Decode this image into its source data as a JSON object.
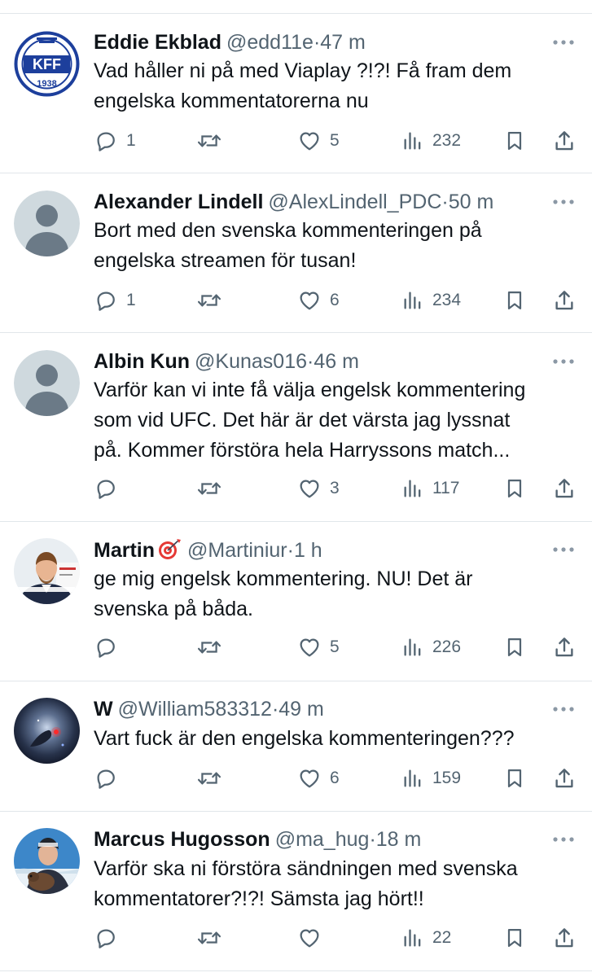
{
  "tweets": [
    {
      "name": "Eddie Ekblad",
      "handle": "@edd11e",
      "dot": "·",
      "time": "47 m",
      "text_lines": [
        "Vad håller ni på med Viaplay ?!?!  Få fram dem",
        "engelska kommentatorerna nu"
      ],
      "replies": "1",
      "retweets": "",
      "likes": "5",
      "views": "232",
      "avatar": "kff-logo",
      "avatar_text": "KFF",
      "avatar_year": "1938"
    },
    {
      "name": "Alexander Lindell",
      "handle": "@AlexLindell_PDC",
      "dot": "·",
      "time": "50 m",
      "text_lines": [
        "Bort med den svenska kommenteringen på",
        "engelska streamen för tusan!"
      ],
      "replies": "1",
      "retweets": "",
      "likes": "6",
      "views": "234",
      "avatar": "default-avatar"
    },
    {
      "name": "Albin Kun",
      "handle": "@Kunas016",
      "dot": "·",
      "time": "46 m",
      "text_lines": [
        "Varför kan vi inte få välja engelsk kommentering",
        "som vid UFC. Det här är det värsta jag lyssnat",
        "på. Kommer förstöra hela Harryssons match..."
      ],
      "replies": "",
      "retweets": "",
      "likes": "3",
      "views": "117",
      "avatar": "default-avatar"
    },
    {
      "name": "Martin",
      "handle": "@Martiniur",
      "dot": "·",
      "time": "1 h",
      "text_lines": [
        "ge mig engelsk kommentering. NU! Det är",
        "svenska på båda."
      ],
      "replies": "",
      "retweets": "",
      "likes": "5",
      "views": "226",
      "avatar": "photo-man-suit",
      "emoji": "dart-target-icon"
    },
    {
      "name": "W",
      "handle": "@William583312",
      "dot": "·",
      "time": "49 m",
      "text_lines": [
        "Vart fuck är den engelska kommenteringen???"
      ],
      "replies": "",
      "retweets": "",
      "likes": "6",
      "views": "159",
      "avatar": "photo-space-nebula"
    },
    {
      "name": "Marcus Hugosson",
      "handle": "@ma_hug",
      "dot": "·",
      "time": "18 m",
      "text_lines": [
        "Varför ska ni förstöra sändningen med svenska",
        "kommentatorer?!?! Sämsta jag hört!!"
      ],
      "replies": "",
      "retweets": "",
      "likes": "",
      "views": "22",
      "avatar": "photo-man-dog-snow"
    }
  ],
  "colors": {
    "text": "#0f1419",
    "secondary": "#536471",
    "divider": "#e1e6ea",
    "default_avatar_bg": "#cfd9de",
    "default_avatar_fg": "#6b7a87",
    "kff_blue": "#1d3f9c"
  }
}
